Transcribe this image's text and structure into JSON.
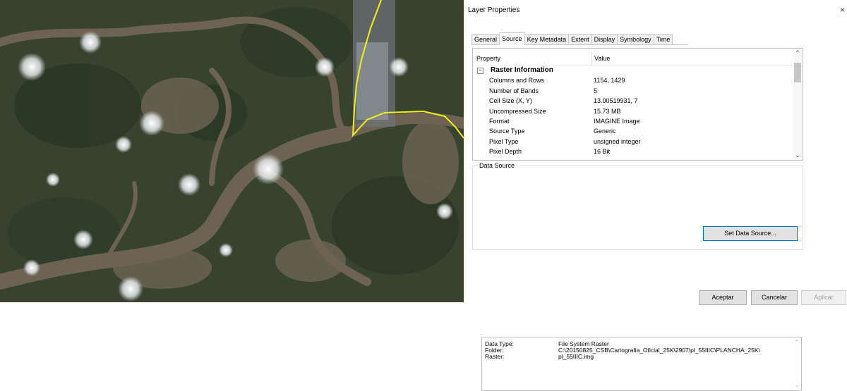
{
  "window": {
    "title": "Layer Properties",
    "close_glyph": "×"
  },
  "tabs": [
    {
      "label": "General",
      "active": false
    },
    {
      "label": "Source",
      "active": true
    },
    {
      "label": "Key Metadata",
      "active": false
    },
    {
      "label": "Extent",
      "active": false
    },
    {
      "label": "Display",
      "active": false
    },
    {
      "label": "Symbology",
      "active": false
    },
    {
      "label": "Time",
      "active": false
    }
  ],
  "properties": {
    "header": {
      "property": "Property",
      "value": "Value"
    },
    "section": {
      "toggle": "−",
      "label": "Raster Information"
    },
    "rows": [
      {
        "key": "Columns and Rows",
        "value": "1154, 1429"
      },
      {
        "key": "Number of Bands",
        "value": "5"
      },
      {
        "key": "Cell Size (X, Y)",
        "value": "13.00519931, 7"
      },
      {
        "key": "Uncompressed Size",
        "value": "15.73 MB"
      },
      {
        "key": "Format",
        "value": "IMAGINE Image"
      },
      {
        "key": "Source Type",
        "value": "Generic"
      },
      {
        "key": "Pixel Type",
        "value": "unsigned integer"
      },
      {
        "key": "Pixel Depth",
        "value": "16 Bit"
      }
    ]
  },
  "data_source": {
    "group_label": "Data Source",
    "data_type_label": "Data Type:",
    "data_type": "File System Raster",
    "folder_label": "Folder:",
    "folder_line1": "C:\\20150825_CSB\\Cartografia_Oficial_25K\\2907\\pl_55IIIC\\PLANCHA_25K\\",
    "raster_label": "Raster:",
    "folder_line2": "pl_55IIIC.img",
    "set_button": "Set Data Source..."
  },
  "footer": {
    "ok": "Aceptar",
    "cancel": "Cancelar",
    "apply": "Aplicar"
  },
  "icons": {
    "scroll_up": "chevron-up-icon",
    "scroll_down": "chevron-down-icon",
    "collapse": "minus-box-icon",
    "close": "close-icon"
  },
  "colors": {
    "boundary_line": "#f2ee1a",
    "focus_border": "#0078d7"
  }
}
